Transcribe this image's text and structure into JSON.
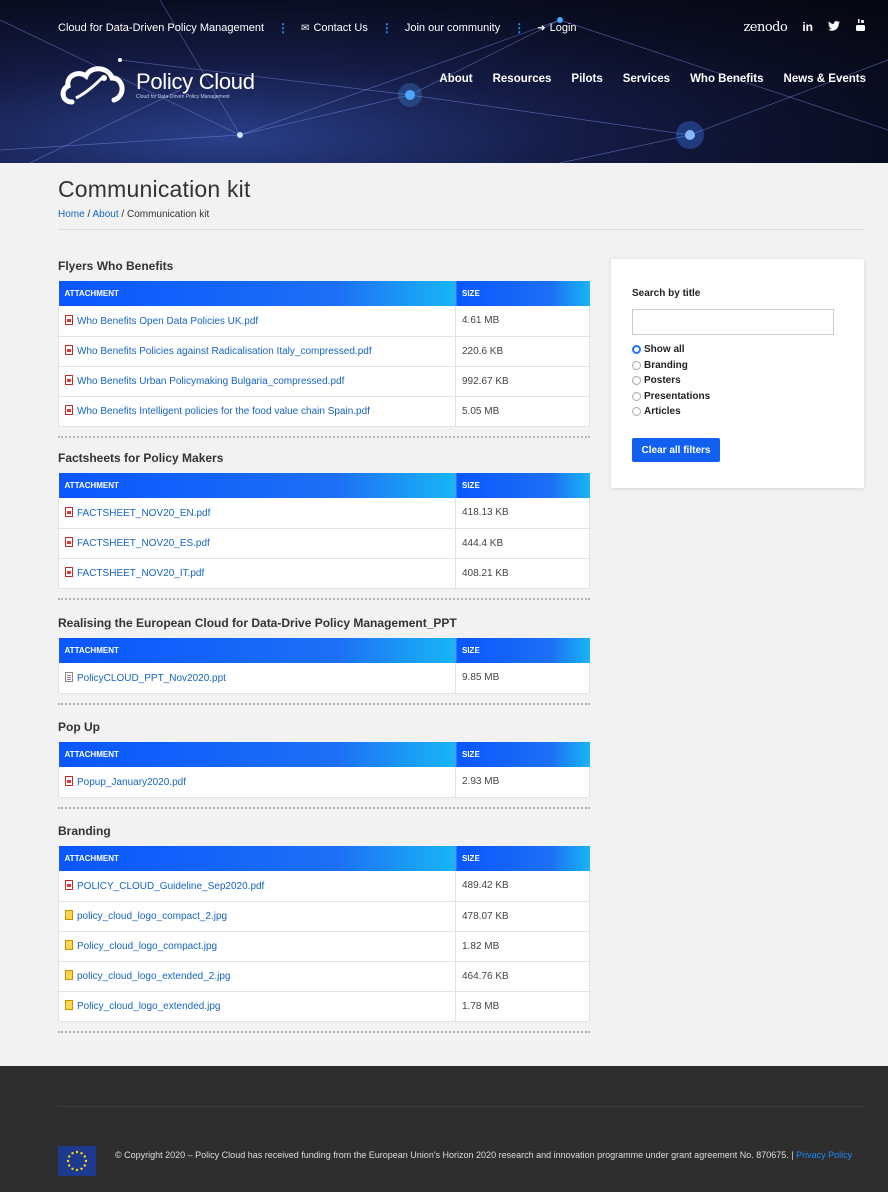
{
  "topbar": {
    "tagline": "Cloud for Data-Driven Policy Management",
    "contact": "Contact Us",
    "community": "Join our community",
    "login": "Login"
  },
  "social": [
    "zenodo",
    "in",
    "twitter-icon",
    "youtube-icon"
  ],
  "logo": {
    "title": "Policy Cloud",
    "subtitle": "Cloud for Data-Driven Policy Management"
  },
  "nav": [
    "About",
    "Resources",
    "Pilots",
    "Services",
    "Who Benefits",
    "News & Events"
  ],
  "page": {
    "title": "Communication kit",
    "breadcrumb": {
      "home": "Home",
      "sep1": " / ",
      "about": "About",
      "sep2": " / ",
      "current": "Communication kit"
    }
  },
  "columns": {
    "attachment": "ATTACHMENT",
    "size": "SIZE"
  },
  "sections": [
    {
      "title": "Flyers Who Benefits",
      "files": [
        {
          "name": "Who Benefits Open Data Policies UK.pdf",
          "size": "4.61 MB",
          "type": "pdf"
        },
        {
          "name": "Who Benefits Policies against Radicalisation Italy_compressed.pdf",
          "size": "220.6 KB",
          "type": "pdf"
        },
        {
          "name": "Who Benefits Urban Policymaking Bulgaria_compressed.pdf",
          "size": "992.67 KB",
          "type": "pdf"
        },
        {
          "name": "Who Benefits Intelligent policies for the food value chain Spain.pdf",
          "size": "5.05 MB",
          "type": "pdf"
        }
      ]
    },
    {
      "title": "Factsheets for Policy Makers",
      "files": [
        {
          "name": "FACTSHEET_NOV20_EN.pdf",
          "size": "418.13 KB",
          "type": "pdf"
        },
        {
          "name": "FACTSHEET_NOV20_ES.pdf",
          "size": "444.4 KB",
          "type": "pdf"
        },
        {
          "name": "FACTSHEET_NOV20_IT.pdf",
          "size": "408.21 KB",
          "type": "pdf"
        }
      ]
    },
    {
      "title": "Realising the European Cloud for Data-Drive Policy Management_PPT",
      "files": [
        {
          "name": "PolicyCLOUD_PPT_Nov2020.ppt",
          "size": "9.85 MB",
          "type": "ppt"
        }
      ]
    },
    {
      "title": "Pop Up",
      "files": [
        {
          "name": "Popup_January2020.pdf",
          "size": "2.93 MB",
          "type": "pdf"
        }
      ]
    },
    {
      "title": "Branding",
      "files": [
        {
          "name": "POLICY_CLOUD_Guideline_Sep2020.pdf",
          "size": "489.42 KB",
          "type": "pdf"
        },
        {
          "name": "policy_cloud_logo_compact_2.jpg",
          "size": "478.07 KB",
          "type": "jpg"
        },
        {
          "name": "Policy_cloud_logo_compact.jpg",
          "size": "1.82 MB",
          "type": "jpg"
        },
        {
          "name": "policy_cloud_logo_extended_2.jpg",
          "size": "464.76 KB",
          "type": "jpg"
        },
        {
          "name": "Policy_cloud_logo_extended.jpg",
          "size": "1.78 MB",
          "type": "jpg"
        }
      ]
    }
  ],
  "filter": {
    "label": "Search by title",
    "search_value": "",
    "options": [
      "Show all",
      "Branding",
      "Posters",
      "Presentations",
      "Articles"
    ],
    "selected": "Show all",
    "clear_label": "Clear all filters"
  },
  "footer": {
    "text": "© Copyright 2020 – Policy Cloud has received funding from the European Union's Horizon 2020 research and innovation programme under grant agreement No. 870675. |",
    "privacy": "Privacy Policy"
  },
  "colors": {
    "accent": "#1160f0",
    "link": "#1565c0",
    "header_bg": "#0a0d22",
    "footer_bg": "#2e2e2e"
  }
}
